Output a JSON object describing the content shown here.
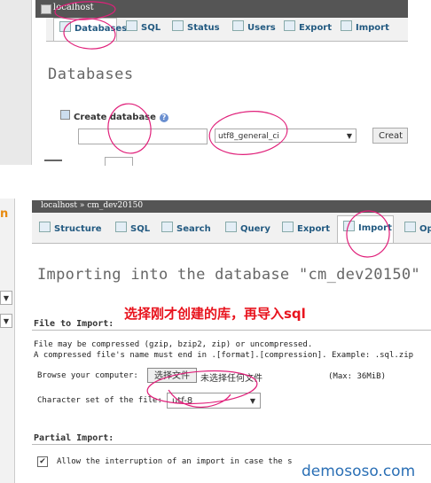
{
  "top": {
    "breadcrumb": "localhost",
    "tabs": [
      {
        "label": "Databases",
        "active": true,
        "icon": "database-icon"
      },
      {
        "label": "SQL",
        "icon": "sql-icon"
      },
      {
        "label": "Status",
        "icon": "status-icon"
      },
      {
        "label": "Users",
        "icon": "users-icon"
      },
      {
        "label": "Export",
        "icon": "export-icon"
      },
      {
        "label": "Import",
        "icon": "import-icon"
      }
    ],
    "title": "Databases",
    "create_label": "Create database",
    "help_glyph": "?",
    "db_name_value": "",
    "collation_value": "utf8_general_ci",
    "create_button": "Creat"
  },
  "bottom": {
    "breadcrumb": "localhost  »  cm_dev20150",
    "tabs": [
      {
        "label": "Structure",
        "icon": "structure-icon"
      },
      {
        "label": "SQL",
        "icon": "sql-icon"
      },
      {
        "label": "Search",
        "icon": "search-icon"
      },
      {
        "label": "Query",
        "icon": "query-icon"
      },
      {
        "label": "Export",
        "icon": "export-icon"
      },
      {
        "label": "Import",
        "active": true,
        "icon": "import-icon"
      },
      {
        "label": "Op",
        "icon": "operations-icon"
      }
    ],
    "title": "Importing into the database \"cm_dev20150\"",
    "annotation": "选择刚才创建的库，再导入sql",
    "file_to_import": "File to Import:",
    "compress_line1": "File may be compressed (gzip, bzip2, zip) or uncompressed.",
    "compress_line2": "A compressed file's name must end in .[format].[compression]. Example: .sql.zip",
    "browse_label": "Browse your computer:",
    "choose_button": "选择文件",
    "no_file": "未选择任何文件",
    "max_size": "(Max: 36MiB)",
    "charset_label": "Character set of the file:",
    "charset_value": "utf-8",
    "partial_import": "Partial Import:",
    "allow_interrupt": "Allow the interruption of an import in case the s",
    "left_fragment": "n"
  },
  "watermark": "demososo.com",
  "colors": {
    "annotation": "#e8141e",
    "tab_text": "#235a81",
    "watermark": "#2a6fb5",
    "scribble": "#e0207a"
  }
}
